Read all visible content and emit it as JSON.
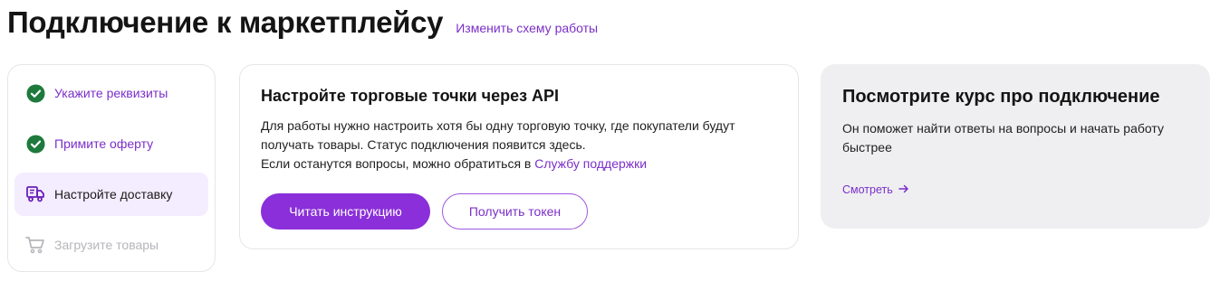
{
  "header": {
    "title": "Подключение к маркетплейсу",
    "change_link": "Изменить схему работы"
  },
  "steps": [
    {
      "label": "Укажите реквизиты",
      "state": "done",
      "icon": "check-circle-icon"
    },
    {
      "label": "Примите оферту",
      "state": "done",
      "icon": "check-circle-icon"
    },
    {
      "label": "Настройте доставку",
      "state": "active",
      "icon": "delivery-truck-icon"
    },
    {
      "label": "Загрузите товары",
      "state": "disabled",
      "icon": "cart-icon"
    }
  ],
  "main_card": {
    "title": "Настройте торговые точки через API",
    "line1": "Для работы нужно настроить хотя бы одну торговую точку, где покупатели будут",
    "line2": "получать товары. Статус подключения появится здесь.",
    "line3_prefix": "Если останутся вопросы, можно обратиться в ",
    "support_link": "Службу поддержки",
    "primary_button": "Читать инструкцию",
    "secondary_button": "Получить токен"
  },
  "side_card": {
    "title": "Посмотрите курс про подключение",
    "text": "Он поможет найти ответы на вопросы и начать работу быстрее",
    "link": "Смотреть",
    "link_icon": "arrow-right-icon"
  },
  "colors": {
    "accent": "#8a2fd9",
    "link": "#7b2fc9",
    "success": "#1e7a3c",
    "active_bg": "#f4ecff",
    "side_bg": "#efeff1"
  }
}
